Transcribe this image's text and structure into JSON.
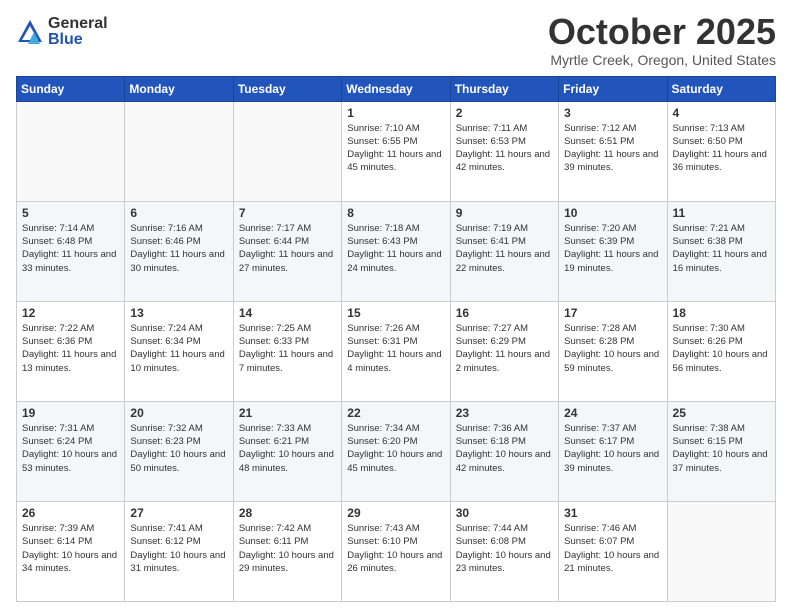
{
  "header": {
    "logo": {
      "general": "General",
      "blue": "Blue"
    },
    "title": "October 2025",
    "location": "Myrtle Creek, Oregon, United States"
  },
  "days_of_week": [
    "Sunday",
    "Monday",
    "Tuesday",
    "Wednesday",
    "Thursday",
    "Friday",
    "Saturday"
  ],
  "weeks": [
    [
      {
        "day": "",
        "info": ""
      },
      {
        "day": "",
        "info": ""
      },
      {
        "day": "",
        "info": ""
      },
      {
        "day": "1",
        "info": "Sunrise: 7:10 AM\nSunset: 6:55 PM\nDaylight: 11 hours and 45 minutes."
      },
      {
        "day": "2",
        "info": "Sunrise: 7:11 AM\nSunset: 6:53 PM\nDaylight: 11 hours and 42 minutes."
      },
      {
        "day": "3",
        "info": "Sunrise: 7:12 AM\nSunset: 6:51 PM\nDaylight: 11 hours and 39 minutes."
      },
      {
        "day": "4",
        "info": "Sunrise: 7:13 AM\nSunset: 6:50 PM\nDaylight: 11 hours and 36 minutes."
      }
    ],
    [
      {
        "day": "5",
        "info": "Sunrise: 7:14 AM\nSunset: 6:48 PM\nDaylight: 11 hours and 33 minutes."
      },
      {
        "day": "6",
        "info": "Sunrise: 7:16 AM\nSunset: 6:46 PM\nDaylight: 11 hours and 30 minutes."
      },
      {
        "day": "7",
        "info": "Sunrise: 7:17 AM\nSunset: 6:44 PM\nDaylight: 11 hours and 27 minutes."
      },
      {
        "day": "8",
        "info": "Sunrise: 7:18 AM\nSunset: 6:43 PM\nDaylight: 11 hours and 24 minutes."
      },
      {
        "day": "9",
        "info": "Sunrise: 7:19 AM\nSunset: 6:41 PM\nDaylight: 11 hours and 22 minutes."
      },
      {
        "day": "10",
        "info": "Sunrise: 7:20 AM\nSunset: 6:39 PM\nDaylight: 11 hours and 19 minutes."
      },
      {
        "day": "11",
        "info": "Sunrise: 7:21 AM\nSunset: 6:38 PM\nDaylight: 11 hours and 16 minutes."
      }
    ],
    [
      {
        "day": "12",
        "info": "Sunrise: 7:22 AM\nSunset: 6:36 PM\nDaylight: 11 hours and 13 minutes."
      },
      {
        "day": "13",
        "info": "Sunrise: 7:24 AM\nSunset: 6:34 PM\nDaylight: 11 hours and 10 minutes."
      },
      {
        "day": "14",
        "info": "Sunrise: 7:25 AM\nSunset: 6:33 PM\nDaylight: 11 hours and 7 minutes."
      },
      {
        "day": "15",
        "info": "Sunrise: 7:26 AM\nSunset: 6:31 PM\nDaylight: 11 hours and 4 minutes."
      },
      {
        "day": "16",
        "info": "Sunrise: 7:27 AM\nSunset: 6:29 PM\nDaylight: 11 hours and 2 minutes."
      },
      {
        "day": "17",
        "info": "Sunrise: 7:28 AM\nSunset: 6:28 PM\nDaylight: 10 hours and 59 minutes."
      },
      {
        "day": "18",
        "info": "Sunrise: 7:30 AM\nSunset: 6:26 PM\nDaylight: 10 hours and 56 minutes."
      }
    ],
    [
      {
        "day": "19",
        "info": "Sunrise: 7:31 AM\nSunset: 6:24 PM\nDaylight: 10 hours and 53 minutes."
      },
      {
        "day": "20",
        "info": "Sunrise: 7:32 AM\nSunset: 6:23 PM\nDaylight: 10 hours and 50 minutes."
      },
      {
        "day": "21",
        "info": "Sunrise: 7:33 AM\nSunset: 6:21 PM\nDaylight: 10 hours and 48 minutes."
      },
      {
        "day": "22",
        "info": "Sunrise: 7:34 AM\nSunset: 6:20 PM\nDaylight: 10 hours and 45 minutes."
      },
      {
        "day": "23",
        "info": "Sunrise: 7:36 AM\nSunset: 6:18 PM\nDaylight: 10 hours and 42 minutes."
      },
      {
        "day": "24",
        "info": "Sunrise: 7:37 AM\nSunset: 6:17 PM\nDaylight: 10 hours and 39 minutes."
      },
      {
        "day": "25",
        "info": "Sunrise: 7:38 AM\nSunset: 6:15 PM\nDaylight: 10 hours and 37 minutes."
      }
    ],
    [
      {
        "day": "26",
        "info": "Sunrise: 7:39 AM\nSunset: 6:14 PM\nDaylight: 10 hours and 34 minutes."
      },
      {
        "day": "27",
        "info": "Sunrise: 7:41 AM\nSunset: 6:12 PM\nDaylight: 10 hours and 31 minutes."
      },
      {
        "day": "28",
        "info": "Sunrise: 7:42 AM\nSunset: 6:11 PM\nDaylight: 10 hours and 29 minutes."
      },
      {
        "day": "29",
        "info": "Sunrise: 7:43 AM\nSunset: 6:10 PM\nDaylight: 10 hours and 26 minutes."
      },
      {
        "day": "30",
        "info": "Sunrise: 7:44 AM\nSunset: 6:08 PM\nDaylight: 10 hours and 23 minutes."
      },
      {
        "day": "31",
        "info": "Sunrise: 7:46 AM\nSunset: 6:07 PM\nDaylight: 10 hours and 21 minutes."
      },
      {
        "day": "",
        "info": ""
      }
    ]
  ]
}
